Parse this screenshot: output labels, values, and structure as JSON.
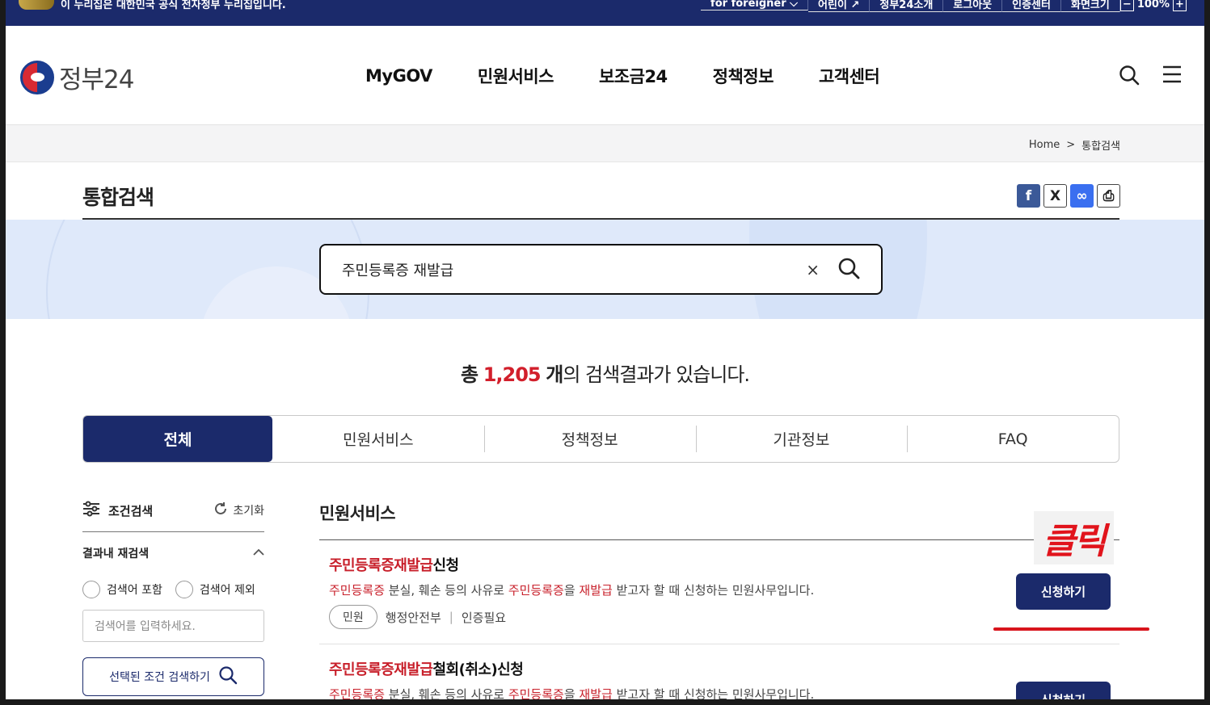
{
  "topbar": {
    "gov_note": "이 누리집은 대한민국 공식 전자정부 누리집입니다.",
    "links": [
      "for foreigner",
      "어린이",
      "정부24소개",
      "로그아웃",
      "인증센터",
      "화면크기"
    ],
    "zoom_minus": "−",
    "zoom_level": "100%",
    "zoom_plus": "+"
  },
  "header": {
    "logo_text": "정부24",
    "nav": [
      "MyGOV",
      "민원서비스",
      "보조금24",
      "정책정보",
      "고객센터"
    ]
  },
  "breadcrumb": {
    "home": "Home",
    "sep": ">",
    "current": "통합검색"
  },
  "page_title": "통합검색",
  "share": {
    "facebook": "f",
    "x": "X",
    "link": "∞",
    "print": "⎙"
  },
  "search": {
    "query": "주민등록증 재발급",
    "clear": "×"
  },
  "total": {
    "prefix": "총",
    "count": "1,205",
    "unit": "개",
    "suffix": "의 검색결과가 있습니다."
  },
  "tabs": [
    "전체",
    "민원서비스",
    "정책정보",
    "기관정보",
    "FAQ"
  ],
  "sidebar": {
    "title": "조건검색",
    "reset": "초기화",
    "sub_title": "결과내 재검색",
    "include": "검색어 포함",
    "exclude": "검색어 제외",
    "placeholder": "검색어를 입력하세요.",
    "search_btn": "선택된 조건 검색하기"
  },
  "results": {
    "section_title": "민원서비스",
    "items": [
      {
        "title_hl": "주민등록증재발급",
        "title_rest": "신청",
        "desc": [
          {
            "t": "주민등록증",
            "hl": true
          },
          {
            "t": " 분실, 훼손 등의 사유로 ",
            "hl": false
          },
          {
            "t": "주민등록증",
            "hl": true
          },
          {
            "t": "을 ",
            "hl": false
          },
          {
            "t": "재발급",
            "hl": true
          },
          {
            "t": " 받고자 할 때 신청하는 민원사무입니다.",
            "hl": false
          }
        ],
        "tag": "민원",
        "org": "행정안전부",
        "auth": "인증필요",
        "button": "신청하기"
      },
      {
        "title_hl": "주민등록증재발급",
        "title_rest": "철회(취소)신청",
        "desc": [
          {
            "t": "주민등록증",
            "hl": true
          },
          {
            "t": " 분실, 훼손 등의 사유로 ",
            "hl": false
          },
          {
            "t": "주민등록증",
            "hl": true
          },
          {
            "t": "을 ",
            "hl": false
          },
          {
            "t": "재발급",
            "hl": true
          },
          {
            "t": " 받고자 할 때 신청하는 민원사무입니다.",
            "hl": false
          }
        ],
        "button": "신청하기"
      }
    ]
  },
  "annotation": {
    "label": "클릭",
    "color": "#e1141c"
  },
  "colors": {
    "navy": "#1b2a6b",
    "highlight": "#c8202b",
    "band": "#dfe9fa"
  }
}
